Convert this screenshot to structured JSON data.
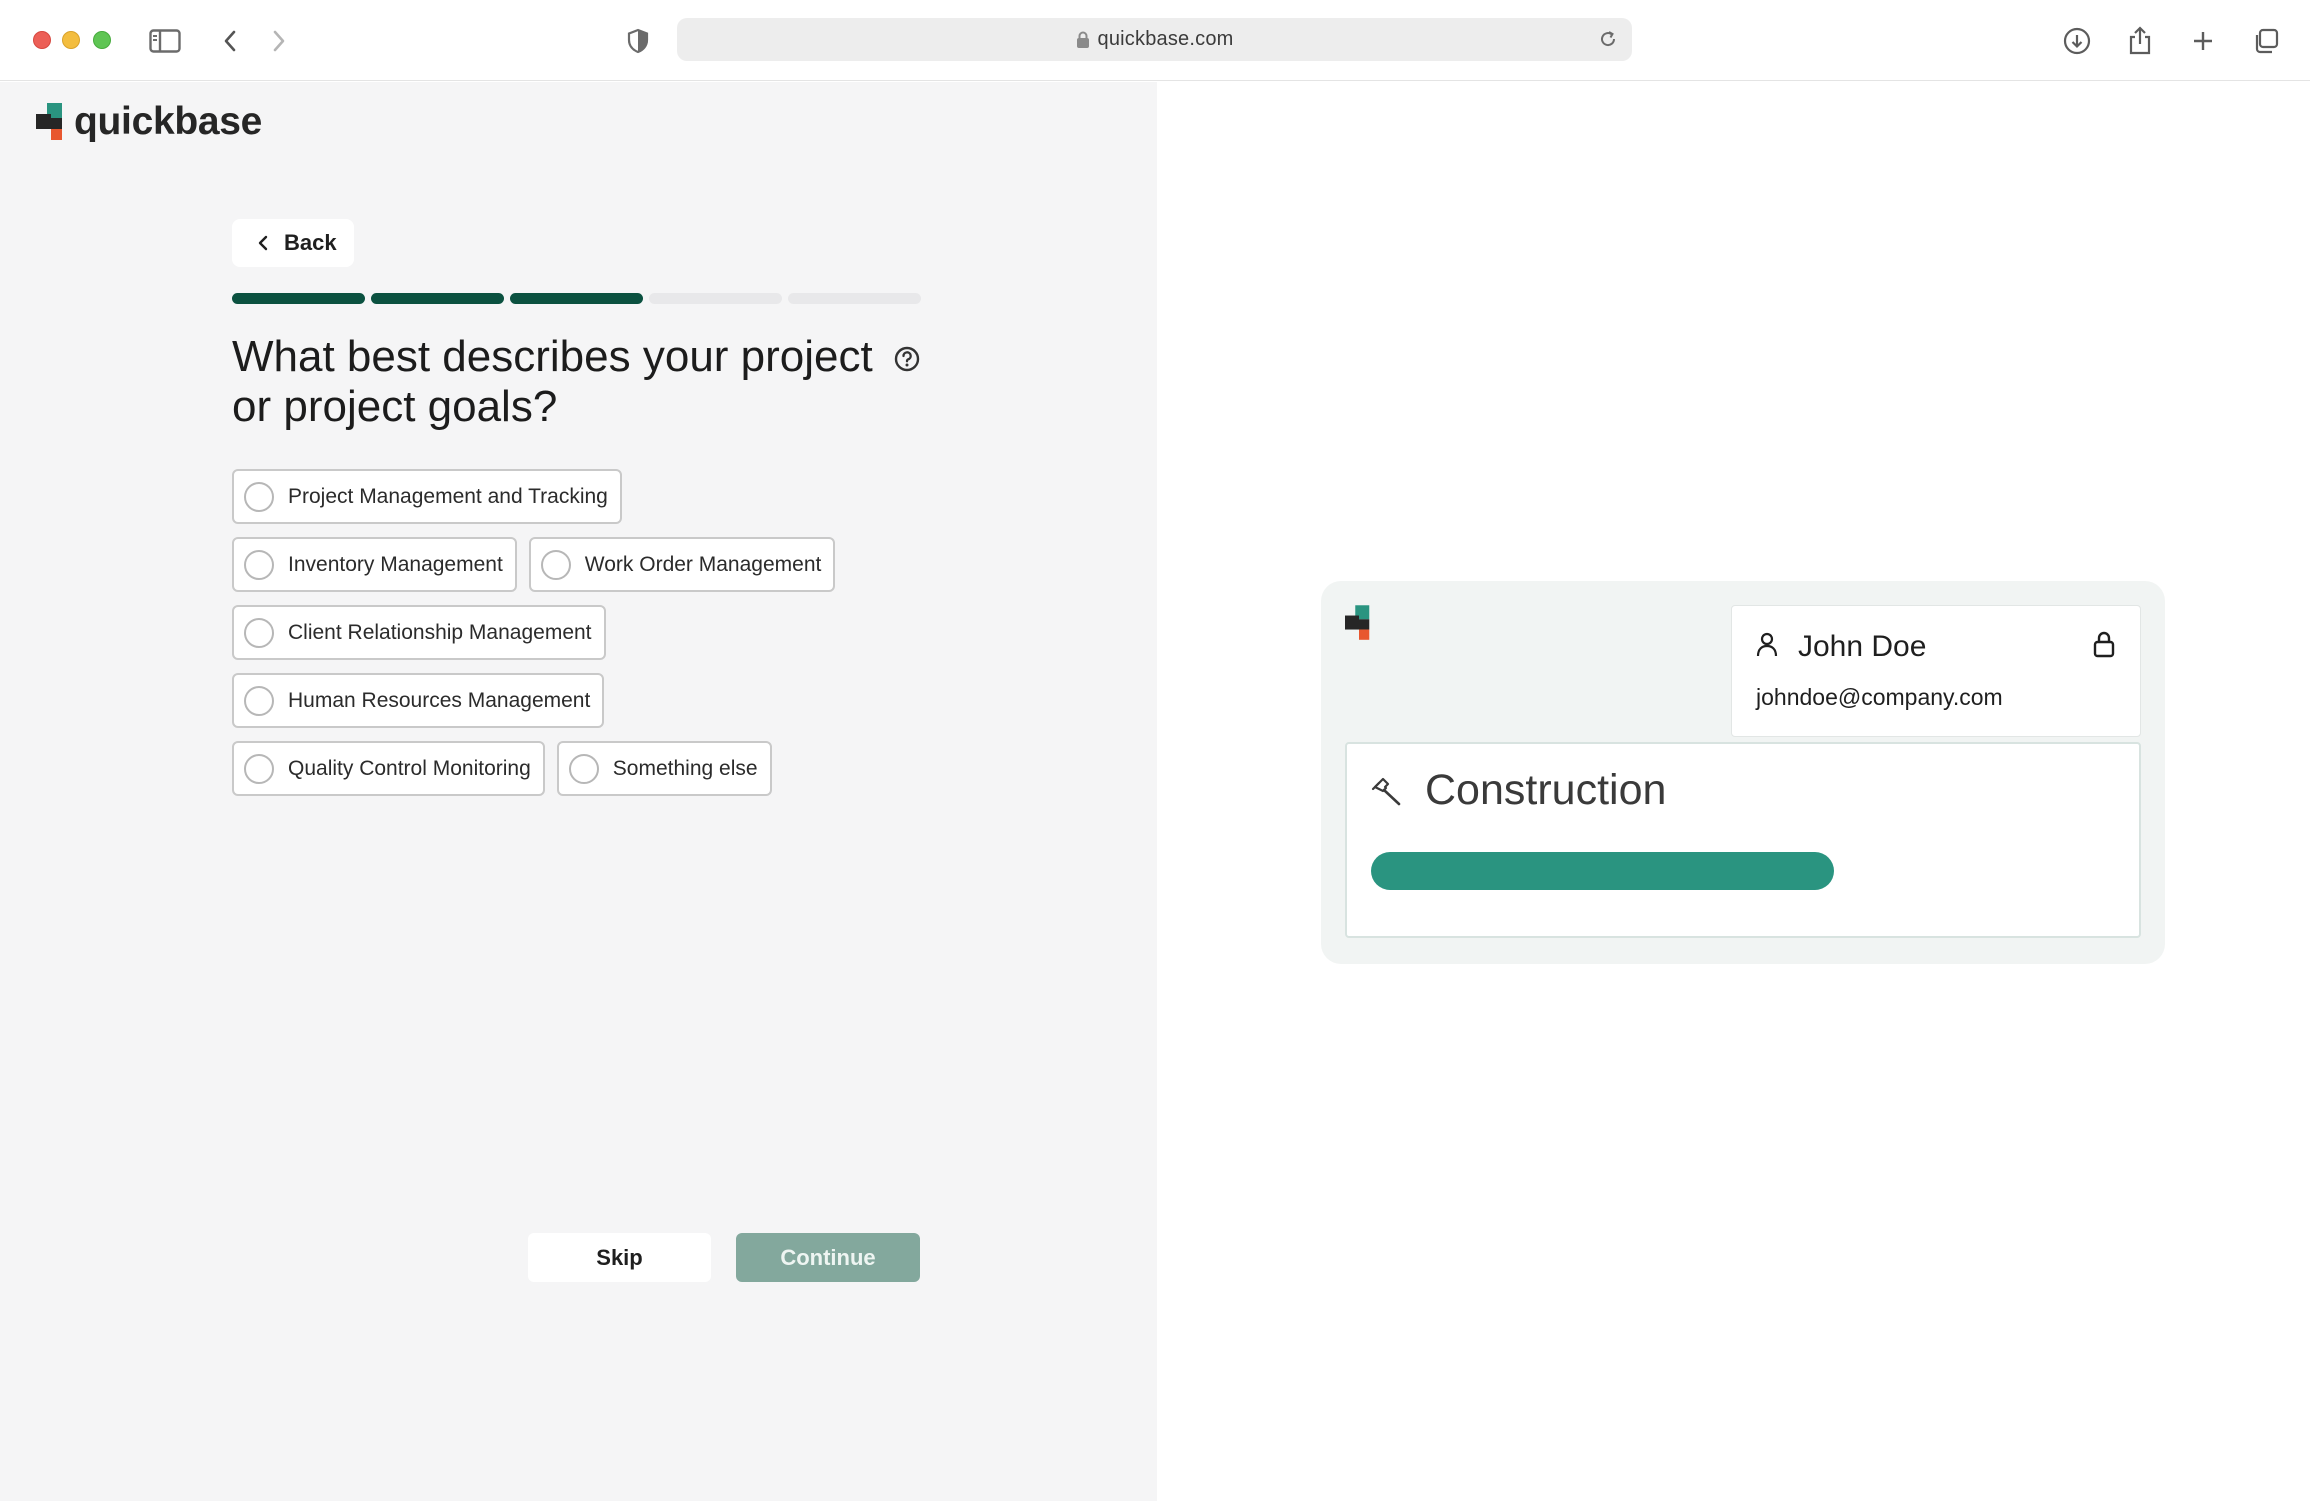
{
  "browser": {
    "url": "quickbase.com"
  },
  "brand": {
    "name": "quickbase",
    "colors": {
      "primary": "#0b5140",
      "accent_teal": "#2a9480",
      "logo_orange": "#e8572f",
      "continue_disabled": "#83a89d"
    }
  },
  "nav": {
    "back_label": "Back"
  },
  "progress": {
    "steps_total": 5,
    "steps_completed": 3
  },
  "question": {
    "text": "What best describes your project or project goals?",
    "help_icon": "question-circle-icon"
  },
  "options": [
    [
      "Project Management and Tracking"
    ],
    [
      "Inventory Management",
      "Work Order Management"
    ],
    [
      "Client Relationship Management"
    ],
    [
      "Human Resources Management"
    ],
    [
      "Quality Control Monitoring",
      "Something else"
    ]
  ],
  "actions": {
    "skip_label": "Skip",
    "continue_label": "Continue"
  },
  "preview": {
    "user_name": "John Doe",
    "user_email": "johndoe@company.com",
    "industry": "Construction",
    "icons": [
      "user-icon",
      "lock-icon",
      "hammer-icon"
    ]
  }
}
